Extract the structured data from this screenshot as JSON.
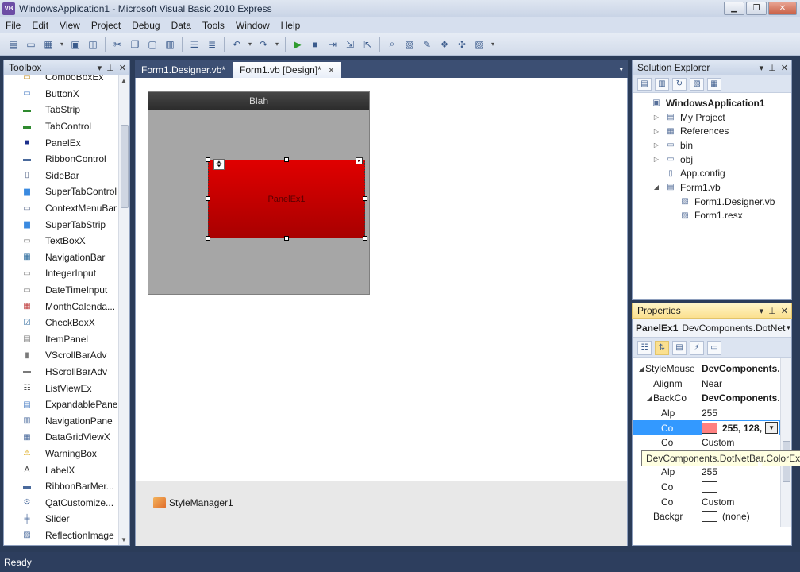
{
  "window": {
    "title": "WindowsApplication1 - Microsoft Visual Basic 2010 Express",
    "app_icon": "VB"
  },
  "menu": [
    "File",
    "Edit",
    "View",
    "Project",
    "Debug",
    "Data",
    "Tools",
    "Window",
    "Help"
  ],
  "toolbox": {
    "title": "Toolbox",
    "items": [
      {
        "label": "ComboBoxEx",
        "icon": "combobox-icon"
      },
      {
        "label": "ButtonX",
        "icon": "button-icon"
      },
      {
        "label": "TabStrip",
        "icon": "tabstrip-icon"
      },
      {
        "label": "TabControl",
        "icon": "tabcontrol-icon"
      },
      {
        "label": "PanelEx",
        "icon": "panel-icon"
      },
      {
        "label": "RibbonControl",
        "icon": "ribbon-icon"
      },
      {
        "label": "SideBar",
        "icon": "sidebar-icon"
      },
      {
        "label": "SuperTabControl",
        "icon": "supertab-icon"
      },
      {
        "label": "ContextMenuBar",
        "icon": "contextmenu-icon"
      },
      {
        "label": "SuperTabStrip",
        "icon": "supertabstrip-icon"
      },
      {
        "label": "TextBoxX",
        "icon": "textbox-icon"
      },
      {
        "label": "NavigationBar",
        "icon": "navbar-icon"
      },
      {
        "label": "IntegerInput",
        "icon": "integer-icon"
      },
      {
        "label": "DateTimeInput",
        "icon": "datetime-icon"
      },
      {
        "label": "MonthCalenda...",
        "icon": "calendar-icon"
      },
      {
        "label": "CheckBoxX",
        "icon": "checkbox-icon"
      },
      {
        "label": "ItemPanel",
        "icon": "itempanel-icon"
      },
      {
        "label": "VScrollBarAdv",
        "icon": "vscroll-icon"
      },
      {
        "label": "HScrollBarAdv",
        "icon": "hscroll-icon"
      },
      {
        "label": "ListViewEx",
        "icon": "listview-icon"
      },
      {
        "label": "ExpandablePanel",
        "icon": "expandable-icon"
      },
      {
        "label": "NavigationPane",
        "icon": "navpane-icon"
      },
      {
        "label": "DataGridViewX",
        "icon": "datagrid-icon"
      },
      {
        "label": "WarningBox",
        "icon": "warning-icon"
      },
      {
        "label": "LabelX",
        "icon": "label-icon"
      },
      {
        "label": "RibbonBarMer...",
        "icon": "ribbonmerge-icon"
      },
      {
        "label": "QatCustomize...",
        "icon": "gear-icon"
      },
      {
        "label": "Slider",
        "icon": "slider-icon"
      },
      {
        "label": "ReflectionImage",
        "icon": "image-icon"
      }
    ]
  },
  "doc_tabs": [
    {
      "label": "Form1.Designer.vb*",
      "active": false
    },
    {
      "label": "Form1.vb [Design]*",
      "active": true
    }
  ],
  "designer": {
    "form_title": "Blah",
    "panel_label": "PanelEx1",
    "panel_color": "#e00000"
  },
  "tray": {
    "component": "StyleManager1"
  },
  "solution_explorer": {
    "title": "Solution Explorer",
    "nodes": [
      {
        "label": "WindowsApplication1",
        "icon": "project-icon",
        "level": 0,
        "bold": true,
        "toggle": ""
      },
      {
        "label": "My Project",
        "icon": "myproject-icon",
        "level": 1,
        "bold": false,
        "toggle": "▷"
      },
      {
        "label": "References",
        "icon": "references-icon",
        "level": 1,
        "bold": false,
        "toggle": "▷"
      },
      {
        "label": "bin",
        "icon": "folder-icon",
        "level": 1,
        "bold": false,
        "toggle": "▷"
      },
      {
        "label": "obj",
        "icon": "folder-icon",
        "level": 1,
        "bold": false,
        "toggle": "▷"
      },
      {
        "label": "App.config",
        "icon": "config-icon",
        "level": 1,
        "bold": false,
        "toggle": ""
      },
      {
        "label": "Form1.vb",
        "icon": "form-icon",
        "level": 1,
        "bold": false,
        "toggle": "◢"
      },
      {
        "label": "Form1.Designer.vb",
        "icon": "vbfile-icon",
        "level": 2,
        "bold": false,
        "toggle": ""
      },
      {
        "label": "Form1.resx",
        "icon": "resx-icon",
        "level": 2,
        "bold": false,
        "toggle": ""
      }
    ]
  },
  "properties": {
    "title": "Properties",
    "object_name": "PanelEx1",
    "object_type": "DevComponents.DotNet",
    "rows": [
      {
        "name": "StyleMouse",
        "value": "DevComponents.I",
        "indent": 0,
        "toggle": "◢",
        "bold_value": true,
        "swatch": null,
        "selected": false
      },
      {
        "name": "Alignm",
        "value": "Near",
        "indent": 1,
        "toggle": "",
        "bold_value": false,
        "swatch": null,
        "selected": false
      },
      {
        "name": "BackCo",
        "value": "DevComponents.I",
        "indent": 1,
        "toggle": "◢",
        "bold_value": true,
        "swatch": null,
        "selected": false
      },
      {
        "name": "Alp",
        "value": "255",
        "indent": 2,
        "toggle": "",
        "bold_value": false,
        "swatch": null,
        "selected": false
      },
      {
        "name": "Co",
        "value": "255, 128,",
        "indent": 2,
        "toggle": "",
        "bold_value": true,
        "swatch": "#ff8080",
        "selected": true
      },
      {
        "name": "Co",
        "value": "Custom",
        "indent": 2,
        "toggle": "",
        "bold_value": false,
        "swatch": null,
        "selected": false
      },
      {
        "name": "",
        "value": "",
        "indent": 2,
        "toggle": "",
        "bold_value": false,
        "swatch": null,
        "selected": false
      },
      {
        "name": "Alp",
        "value": "255",
        "indent": 2,
        "toggle": "",
        "bold_value": false,
        "swatch": null,
        "selected": false
      },
      {
        "name": "Co",
        "value": "",
        "indent": 2,
        "toggle": "",
        "bold_value": false,
        "swatch": "#ffffff",
        "selected": false
      },
      {
        "name": "Co",
        "value": "Custom",
        "indent": 2,
        "toggle": "",
        "bold_value": false,
        "swatch": null,
        "selected": false
      },
      {
        "name": "Backgr",
        "value": "(none)",
        "indent": 1,
        "toggle": "",
        "bold_value": false,
        "swatch": "#ffffff",
        "selected": false
      }
    ]
  },
  "tooltip": "DevComponents.DotNetBar.ColorEx",
  "status": "Ready"
}
